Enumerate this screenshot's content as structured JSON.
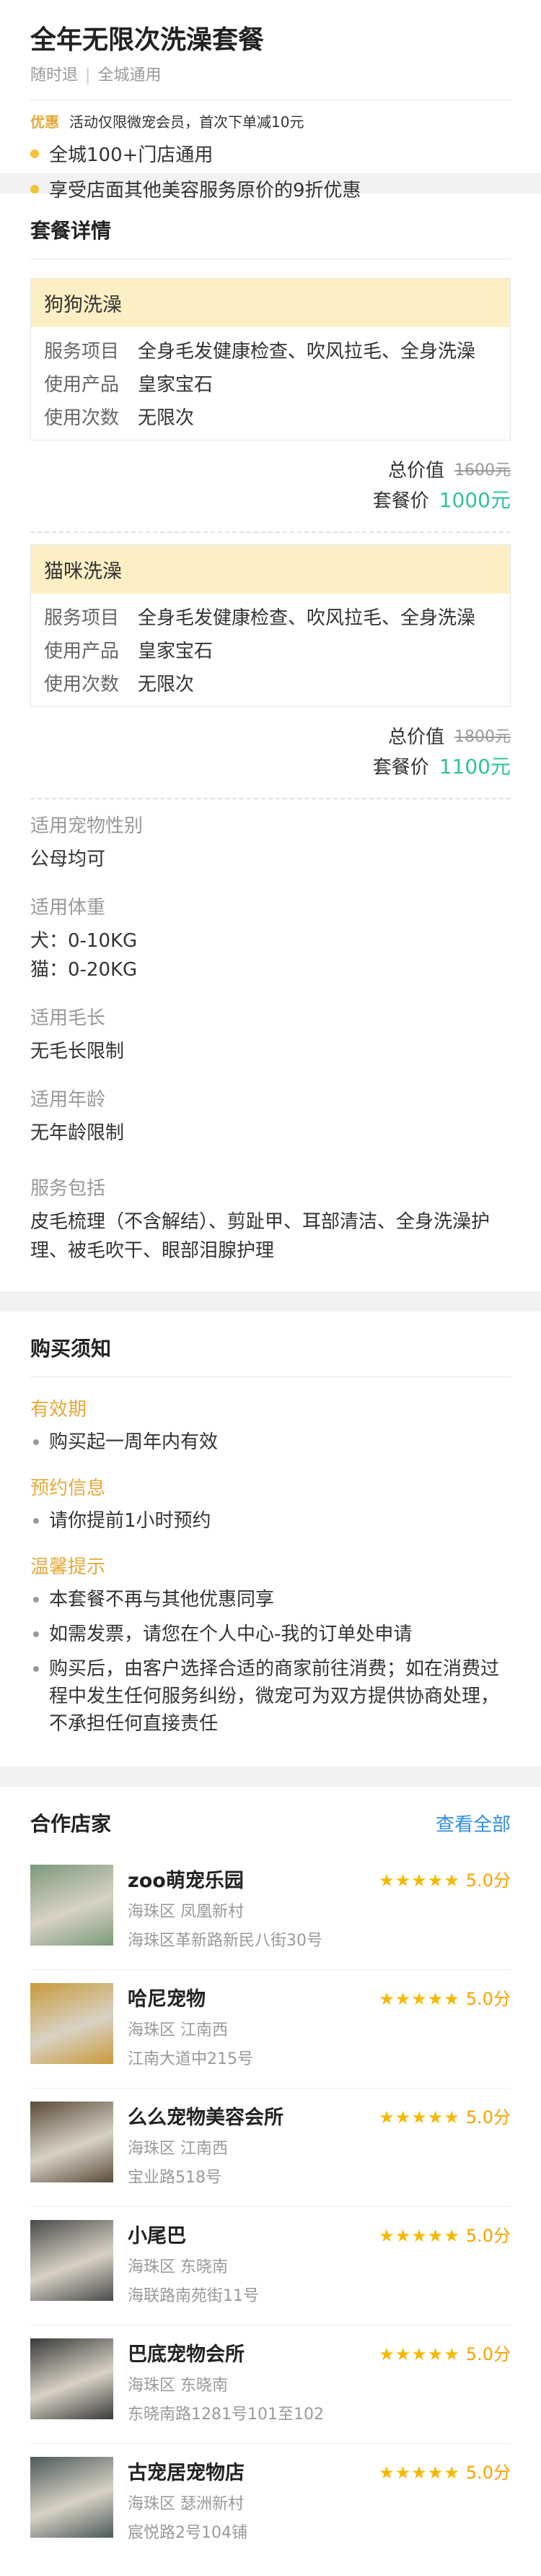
{
  "header": {
    "title": "全年无限次洗澡套餐",
    "tags": [
      "随时退",
      "全城通用"
    ],
    "promo_tag": "优惠",
    "promo_text": "活动仅限微宠会员，首次下单减10元",
    "benefits": [
      "全城100+门店通用",
      "享受店面其他美容服务原价的9折优惠"
    ]
  },
  "details": {
    "section_title": "套餐详情",
    "packages": [
      {
        "name": "狗狗洗澡",
        "rows": [
          {
            "k": "服务项目",
            "v": "全身毛发健康检查、吹风拉毛、全身洗澡"
          },
          {
            "k": "使用产品",
            "v": "皇家宝石"
          },
          {
            "k": "使用次数",
            "v": "无限次"
          }
        ],
        "total_label": "总价值",
        "total_value": "1600元",
        "price_label": "套餐价",
        "price_value": "1000元"
      },
      {
        "name": "猫咪洗澡",
        "rows": [
          {
            "k": "服务项目",
            "v": "全身毛发健康检查、吹风拉毛、全身洗澡"
          },
          {
            "k": "使用产品",
            "v": "皇家宝石"
          },
          {
            "k": "使用次数",
            "v": "无限次"
          }
        ],
        "total_label": "总价值",
        "total_value": "1800元",
        "price_label": "套餐价",
        "price_value": "1100元"
      }
    ],
    "attributes": [
      {
        "k": "适用宠物性别",
        "v": [
          "公母均可"
        ]
      },
      {
        "k": "适用体重",
        "v": [
          "犬：0-10KG",
          "猫：0-20KG"
        ]
      },
      {
        "k": "适用毛长",
        "v": [
          "无毛长限制"
        ]
      },
      {
        "k": "适用年龄",
        "v": [
          "无年龄限制"
        ]
      },
      {
        "k": "服务包括",
        "v": [
          "皮毛梳理（不含解结）、剪趾甲、耳部清洁、全身洗澡护理、被毛吹干、眼部泪腺护理"
        ]
      }
    ]
  },
  "notice": {
    "section_title": "购买须知",
    "groups": [
      {
        "h": "有效期",
        "items": [
          "购买起一周年内有效"
        ]
      },
      {
        "h": "预约信息",
        "items": [
          "请你提前1小时预约"
        ]
      },
      {
        "h": "温馨提示",
        "items": [
          "本套餐不再与其他优惠同享",
          "如需发票，请您在个人中心-我的订单处申请",
          "购买后，由客户选择合适的商家前往消费；如在消费过程中发生任何服务纠纷，微宠可为双方提供协商处理，不承担任何直接责任"
        ]
      }
    ]
  },
  "stores": {
    "section_title": "合作店家",
    "view_all": "查看全部",
    "stars": "★★★★★",
    "list": [
      {
        "name": "zoo萌宠乐园",
        "score": "5.0分",
        "area": "海珠区   凤凰新村",
        "addr": "海珠区革新路新民八街30号",
        "color": "#7a9a7a"
      },
      {
        "name": "哈尼宠物",
        "score": "5.0分",
        "area": "海珠区   江南西",
        "addr": "江南大道中215号",
        "color": "#c89a3a"
      },
      {
        "name": "么么宠物美容会所",
        "score": "5.0分",
        "area": "海珠区   江南西",
        "addr": "宝业路518号",
        "color": "#5a4a3a"
      },
      {
        "name": "小尾巴",
        "score": "5.0分",
        "area": "海珠区   东晓南",
        "addr": "海联路南苑街11号",
        "color": "#4a4a4a"
      },
      {
        "name": "巴底宠物会所",
        "score": "5.0分",
        "area": "海珠区   东晓南",
        "addr": "东晓南路1281号101至102",
        "color": "#3a3a3a"
      },
      {
        "name": "古宠居宠物店",
        "score": "5.0分",
        "area": "海珠区   瑟洲新村",
        "addr": "宸悦路2号104铺",
        "color": "#4a5a5a"
      }
    ]
  }
}
